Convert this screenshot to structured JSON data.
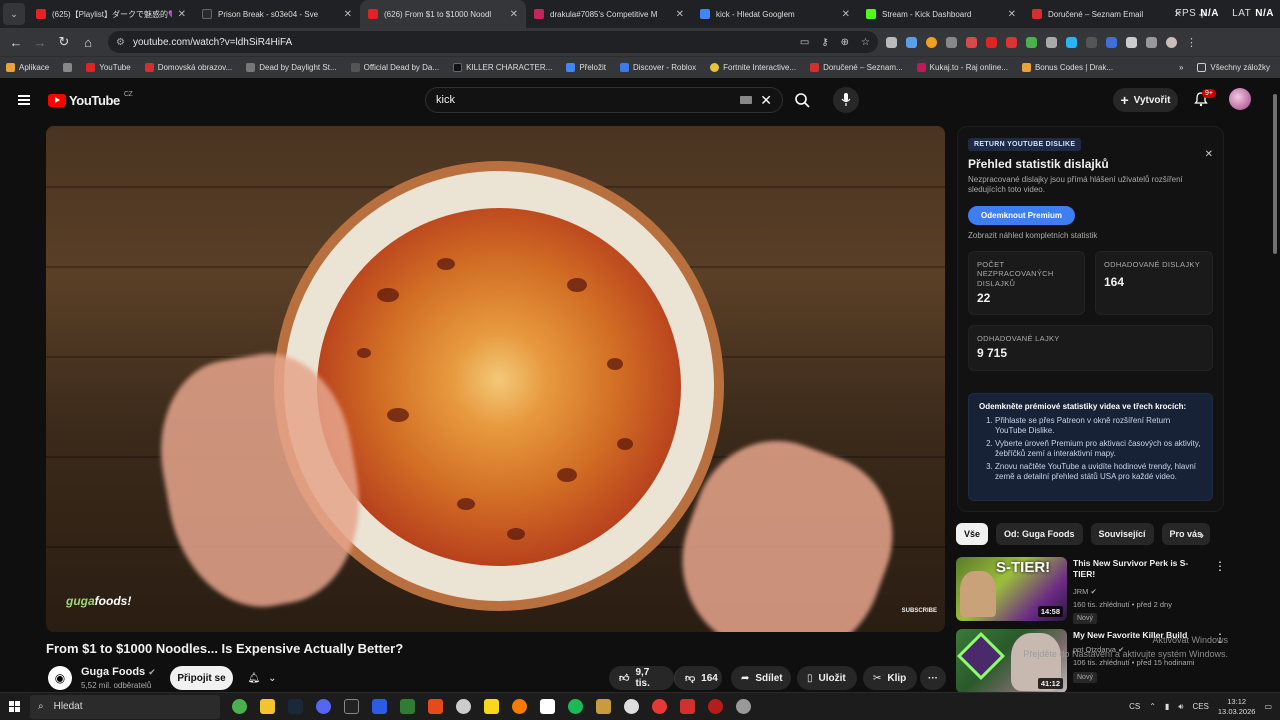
{
  "tabs": [
    {
      "title": "(625)【Playlist】ダークで魅惑的💜",
      "color": "#e02424",
      "active": false
    },
    {
      "title": "Prison Break - s03e04 - Sve",
      "color": "#2a2a2a",
      "active": false
    },
    {
      "title": "(626) From $1 to $1000 Noodl",
      "color": "#e02424",
      "active": true
    },
    {
      "title": "drakula#7085's Competitive M",
      "color": "#c0265a",
      "active": false
    },
    {
      "title": "kick - Hledat Googlem",
      "color": "#4285f4",
      "active": false
    },
    {
      "title": "Stream - Kick Dashboard",
      "color": "#53fc18",
      "active": false
    },
    {
      "title": "Doručené – Seznam Email",
      "color": "#d32f2f",
      "active": false
    }
  ],
  "fps": {
    "label": "FPS",
    "value": "N/A",
    "lat_label": "LAT",
    "lat_value": "N/A"
  },
  "url": "youtube.com/watch?v=ldhSiR4HiFA",
  "bookmarks": [
    "Aplikace",
    "YouTube",
    "Domovská obrazov...",
    "Dead by Daylight St...",
    "Official Dead by Da...",
    "KILLER CHARACTER...",
    "Přeložit",
    "Discover - Roblox",
    "Fortnite Interactive...",
    "Doručené – Seznam...",
    "Kukaj.to - Raj online...",
    "Bonus Codes | Drak..."
  ],
  "bookmarks_all": "Všechny záložky",
  "youtube": {
    "logo": "YouTube",
    "country": "CZ",
    "search_value": "kick",
    "create_label": "Vytvořit",
    "notif_count": "9+"
  },
  "video": {
    "title": "From $1 to $1000 Noodles... Is Expensive Actually Better?",
    "watermark_a": "guga",
    "watermark_b": "foods!",
    "subscribe_mark": "SUBSCRIBE"
  },
  "channel": {
    "name": "Guga Foods",
    "subs": "5,52 mil. odběratelů",
    "join_label": "Připojit se"
  },
  "actions": {
    "likes": "9,7 tis.",
    "dislikes": "164",
    "share": "Sdílet",
    "save": "Uložit",
    "clip": "Klip"
  },
  "rydpanel": {
    "tag": "RETURN YOUTUBE DISLIKE",
    "heading": "Přehled statistik dislajků",
    "description": "Nezpracované dislajky jsou přímá hlášení uživatelů rozšíření sledujících toto video.",
    "premium_btn": "Odemknout Premium",
    "preview_link": "Zobrazit náhled kompletních statistik",
    "stat1_label": "POČET NEZPRACOVANÝCH DISLAJKŮ",
    "stat1_value": "22",
    "stat2_label": "ODHADOVANÉ DISLAJKY",
    "stat2_value": "164",
    "stat3_label": "ODHADOVANÉ LAJKY",
    "stat3_value": "9 715",
    "steps_title": "Odemkněte prémiové statistiky videa ve třech krocích:",
    "steps": [
      "Přihlaste se přes Patreon v okně rozšíření Return YouTube Dislike.",
      "Vyberte úroveň Premium pro aktivaci časových os aktivity, žebříčků zemí a interaktivní mapy.",
      "Znovu načtěte YouTube a uvidíte hodinové trendy, hlavní země a detailní přehled států USA pro každé video."
    ]
  },
  "chips": [
    "Vše",
    "Od: Guga Foods",
    "Související",
    "Pro vás"
  ],
  "recommended": [
    {
      "title": "This New Survivor Perk is S-TIER!",
      "channel": "JRM",
      "meta": "160 tis. zhlédnutí • před 2 dny",
      "badge": "Nový",
      "duration": "14:58",
      "thumb_text": "S-TIER!"
    },
    {
      "title": "My New Favorite Killer Build",
      "channel": "pot Otzdarva",
      "meta": "106 tis. zhlédnutí • před 15 hodinami",
      "badge": "Nový",
      "duration": "41:12",
      "thumb_text": ""
    }
  ],
  "windows_watermark": "Aktivovat Windows\nPřejděte do Nastavení a aktivujte systém Windows.",
  "taskbar": {
    "search": "Hledat",
    "lang1": "CS",
    "lang2": "CES",
    "time": "13:12",
    "date": "13.03.2026"
  }
}
